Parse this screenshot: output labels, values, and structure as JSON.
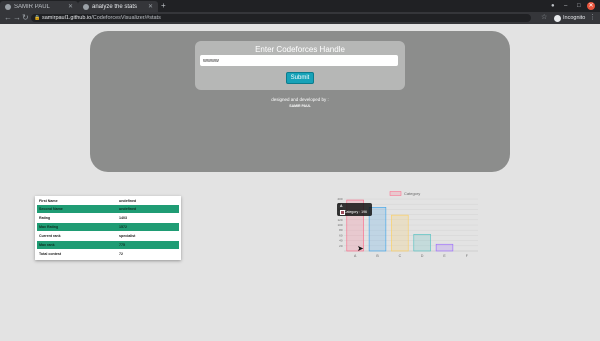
{
  "browser": {
    "tabs": [
      {
        "label": "SAMIR PAUL"
      },
      {
        "label": "analyze the stats"
      }
    ],
    "new_tab": "+",
    "url_host": "samirpaul1.github.io",
    "url_path": "/CodeforcesVisualizer/#stats",
    "incognito_label": "Incognito"
  },
  "hero": {
    "form_title": "Enter Codeforces Handle",
    "handle_value": "wwww",
    "submit_label": "Submit",
    "credit_line": "designed and developed by :",
    "author": "SAMIR PAUL"
  },
  "stats": {
    "rows": [
      {
        "key": "First Name",
        "value": "undefined"
      },
      {
        "key": "Second Name",
        "value": "undefined"
      },
      {
        "key": "Rating",
        "value": "1403"
      },
      {
        "key": "Max Rating",
        "value": "1572"
      },
      {
        "key": "Current rank",
        "value": "specialist"
      },
      {
        "key": "Max rank",
        "value": "775"
      },
      {
        "key": "Total contest",
        "value": "72"
      }
    ]
  },
  "tooltip": {
    "title": "A",
    "label": "Category : 196"
  },
  "chart_data": {
    "type": "bar",
    "categories": [
      "A",
      "B",
      "C",
      "D",
      "E",
      "F"
    ],
    "series": [
      {
        "name": "Category",
        "values": [
          196,
          168,
          138,
          64,
          26,
          0
        ]
      }
    ],
    "ylim": [
      0,
      200
    ],
    "yticks": [
      20,
      40,
      60,
      80,
      100,
      120,
      140,
      160,
      180,
      200
    ],
    "legend": "top",
    "grid": true,
    "colors": {
      "fill": [
        "rgba(255,99,132,0.2)",
        "rgba(54,162,235,0.2)",
        "rgba(255,206,86,0.2)",
        "rgba(75,192,192,0.2)",
        "rgba(153,102,255,0.2)",
        "rgba(255,159,64,0.2)"
      ],
      "stroke": [
        "#ff6384",
        "#36a2eb",
        "#ffce56",
        "#4bc0c0",
        "#9966ff",
        "#ff9f40"
      ]
    }
  }
}
